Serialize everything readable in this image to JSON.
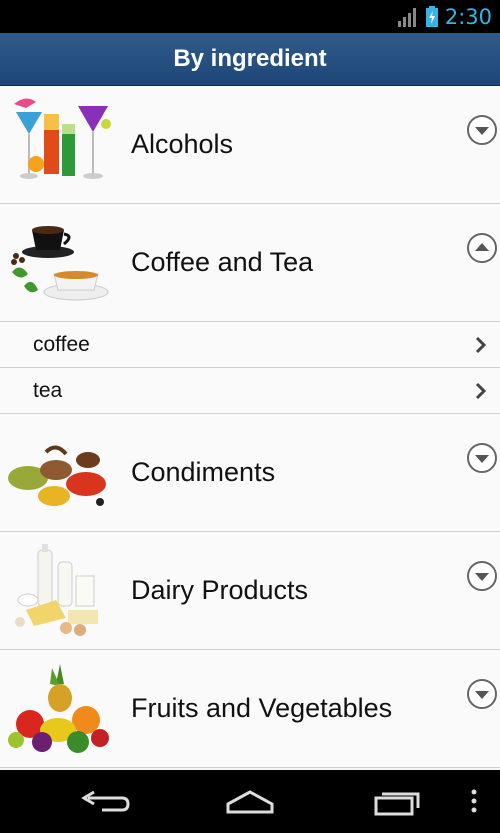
{
  "status": {
    "time": "2:30"
  },
  "header": {
    "title": "By ingredient"
  },
  "categories": [
    {
      "label": "Alcohols",
      "expanded": false
    },
    {
      "label": "Coffee and Tea",
      "expanded": true,
      "items": [
        "coffee",
        "tea"
      ]
    },
    {
      "label": "Condiments",
      "expanded": false
    },
    {
      "label": "Dairy Products",
      "expanded": false
    },
    {
      "label": "Fruits and Vegetables",
      "expanded": false
    }
  ],
  "icons": {
    "expand": "chevron-down-circle-icon",
    "collapse": "chevron-up-circle-icon",
    "navigate": "chevron-right-icon",
    "nav_back": "back-icon",
    "nav_home": "home-icon",
    "nav_recents": "recents-icon",
    "nav_menu": "overflow-menu-icon"
  },
  "colors": {
    "title_bar": "#2a5584",
    "clock": "#33b5e5"
  }
}
